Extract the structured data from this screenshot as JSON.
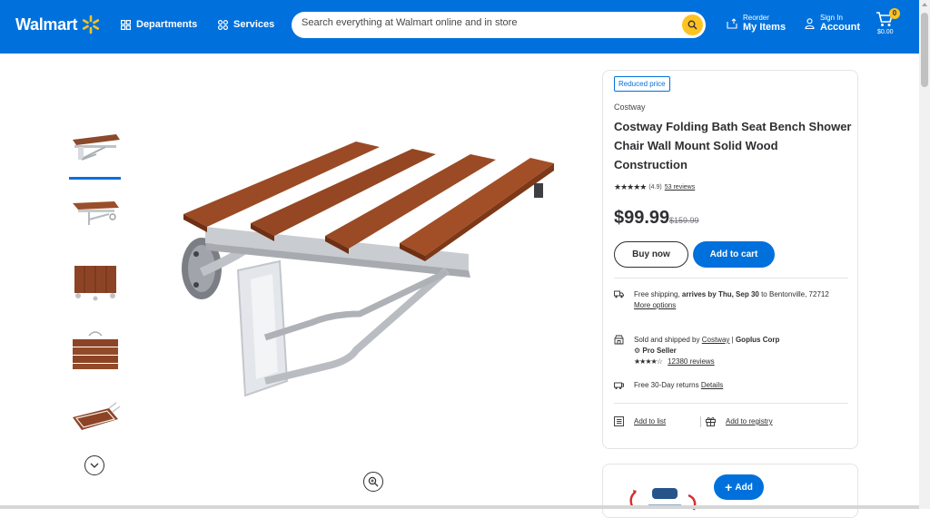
{
  "header": {
    "logo_text": "Walmart",
    "departments_label": "Departments",
    "services_label": "Services",
    "search_placeholder": "Search everything at Walmart online and in store",
    "reorder_small": "Reorder",
    "reorder_big": "My Items",
    "signin_small": "Sign In",
    "signin_big": "Account",
    "cart_count": "0",
    "cart_total": "$0.00"
  },
  "colors": {
    "brand_blue": "#0071dc",
    "spark_yellow": "#ffc220"
  },
  "gallery": {
    "thumbnail_count": 5,
    "selected_index": 0
  },
  "product": {
    "badge": "Reduced price",
    "brand": "Costway",
    "title": "Costway Folding Bath Seat Bench Shower Chair Wall Mount Solid Wood Construction",
    "rating_text": "(4.9)",
    "reviews_link": "53 reviews",
    "price": "$99.99",
    "was_price": "$159.99",
    "buy_now": "Buy now",
    "add_to_cart": "Add to cart"
  },
  "fulfillment": {
    "shipping_prefix": "Free shipping, ",
    "shipping_bold": "arrives by Thu, Sep 30",
    "shipping_suffix": " to Bentonville, 72712",
    "more_options": "More options",
    "sold_prefix": "Sold and shipped by ",
    "sold_link": "Costway",
    "sold_sep": " | ",
    "sold_bold": "Goplus Corp",
    "pro_seller": "Pro Seller",
    "seller_reviews": "12380 reviews",
    "returns_text": "Free 30-Day returns ",
    "returns_link": "Details",
    "add_to_list": "Add to list",
    "add_to_registry": "Add to registry"
  },
  "secondary": {
    "add_label": "Add"
  }
}
